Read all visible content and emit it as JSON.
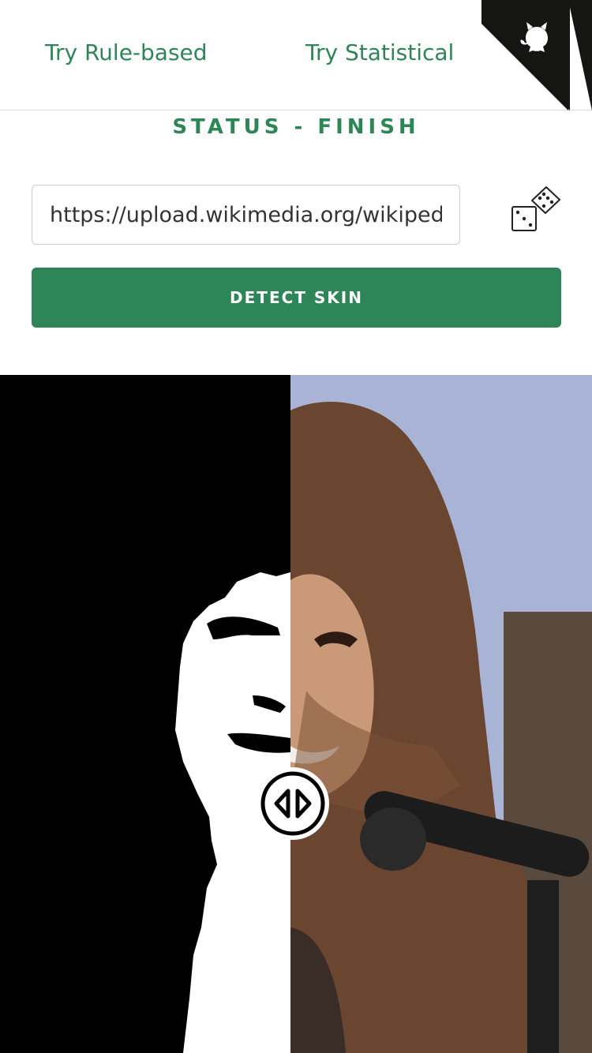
{
  "nav": {
    "rule_based_label": "Try Rule-based",
    "statistical_label": "Try Statistical"
  },
  "status": {
    "text": "STATUS - FINISH"
  },
  "form": {
    "url_value": "https://upload.wikimedia.org/wikipedia",
    "detect_label": "DETECT SKIN"
  },
  "icons": {
    "corner": "github-cat-icon",
    "dice": "dice-icon",
    "slider": "slider-arrows-icon"
  },
  "colors": {
    "accent": "#2e8557",
    "corner_bg": "#151513"
  },
  "comparer": {
    "split_fraction": 0.49
  }
}
